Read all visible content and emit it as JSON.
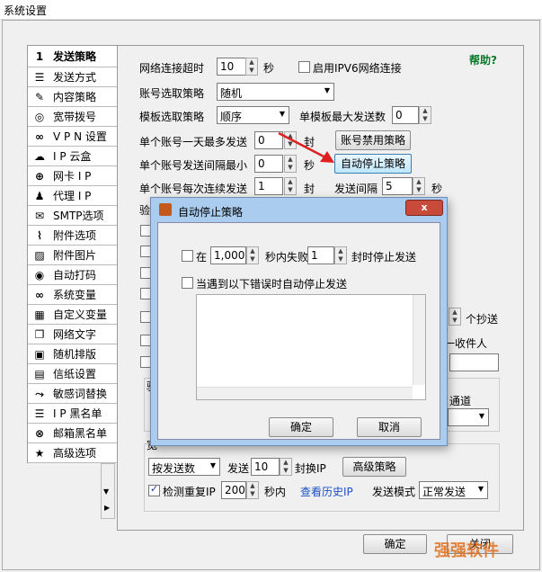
{
  "window_title": "系统设置",
  "nav": [
    {
      "label": "发送策略",
      "icon": "person-icon",
      "glyph": "1"
    },
    {
      "label": "发送方式",
      "icon": "list-icon",
      "glyph": "☰"
    },
    {
      "label": "内容策略",
      "icon": "pencil-icon",
      "glyph": "✎"
    },
    {
      "label": "宽带拨号",
      "icon": "globe-icon",
      "glyph": "◎"
    },
    {
      "label": "V P N 设置",
      "icon": "link-icon",
      "glyph": "∞"
    },
    {
      "label": "I P 云盒",
      "icon": "cloud-icon",
      "glyph": "☁"
    },
    {
      "label": "网卡 I P",
      "icon": "network-icon",
      "glyph": "⊕"
    },
    {
      "label": "代理 I P",
      "icon": "user-icon",
      "glyph": "♟"
    },
    {
      "label": "SMTP选项",
      "icon": "mail-icon",
      "glyph": "✉"
    },
    {
      "label": "附件选项",
      "icon": "attach-icon",
      "glyph": "⌇"
    },
    {
      "label": "附件图片",
      "icon": "image-icon",
      "glyph": "▨"
    },
    {
      "label": "自动打码",
      "icon": "eye-icon",
      "glyph": "◉"
    },
    {
      "label": "系统变量",
      "icon": "infinity-icon",
      "glyph": "∞"
    },
    {
      "label": "自定义变量",
      "icon": "grid-icon",
      "glyph": "▦"
    },
    {
      "label": "网络文字",
      "icon": "book-icon",
      "glyph": "❐"
    },
    {
      "label": "随机排版",
      "icon": "layout-icon",
      "glyph": "▣"
    },
    {
      "label": "信纸设置",
      "icon": "paper-icon",
      "glyph": "▤"
    },
    {
      "label": "敏感词替换",
      "icon": "replace-icon",
      "glyph": "⤳"
    },
    {
      "label": "I P 黑名单",
      "icon": "blacklist-icon",
      "glyph": "☰"
    },
    {
      "label": "邮箱黑名单",
      "icon": "block-icon",
      "glyph": "⊗"
    },
    {
      "label": "高级选项",
      "icon": "star-icon",
      "glyph": "★"
    }
  ],
  "form": {
    "help": "帮助?",
    "timeout_label": "网络连接超时",
    "timeout_value": "10",
    "sec": "秒",
    "ipv6_label": "启用IPV6网络连接",
    "account_select_label": "账号选取策略",
    "account_select_value": "随机",
    "template_label": "模板选取策略",
    "template_value": "顺序",
    "template_max_label": "单模板最大发送数",
    "template_max_value": "0",
    "daily_max_label": "单个账号一天最多发送",
    "daily_max_value": "0",
    "seal": "封",
    "disable_btn": "账号禁用策略",
    "interval_label": "单个账号发送间隔最小",
    "interval_value": "0",
    "autostop_btn": "自动停止策略",
    "consecutive_label": "单个账号每次连续发送",
    "consecutive_value": "1",
    "send_interval_label": "发送间隔",
    "send_interval_value": "5",
    "partial_label": "验",
    "right_per_sec": "个抄送",
    "right_recipient": "一收件人",
    "right_channel": "通道",
    "send_mode_value": "按发送数",
    "send_label": "发送",
    "send_value": "10",
    "switch_ip": "封换IP",
    "adv_btn": "高级策略",
    "check_ip_label": "检测重复IP",
    "check_ip_value": "200",
    "within_sec": "秒内",
    "history_link": "查看历史IP",
    "send_mode_label": "发送模式",
    "send_mode_sel": "正常发送",
    "ok": "确定",
    "close": "关闭",
    "section_hint": "宽"
  },
  "modal": {
    "title": "自动停止策略",
    "close": "x",
    "in_label": "在",
    "seconds_value": "1,000",
    "fail_label": "秒内失败",
    "fail_value": "1",
    "stop_label": "封时停止发送",
    "error_label": "当遇到以下错误时自动停止发送",
    "ok": "确定",
    "cancel": "取消"
  },
  "watermark": "强强软件"
}
